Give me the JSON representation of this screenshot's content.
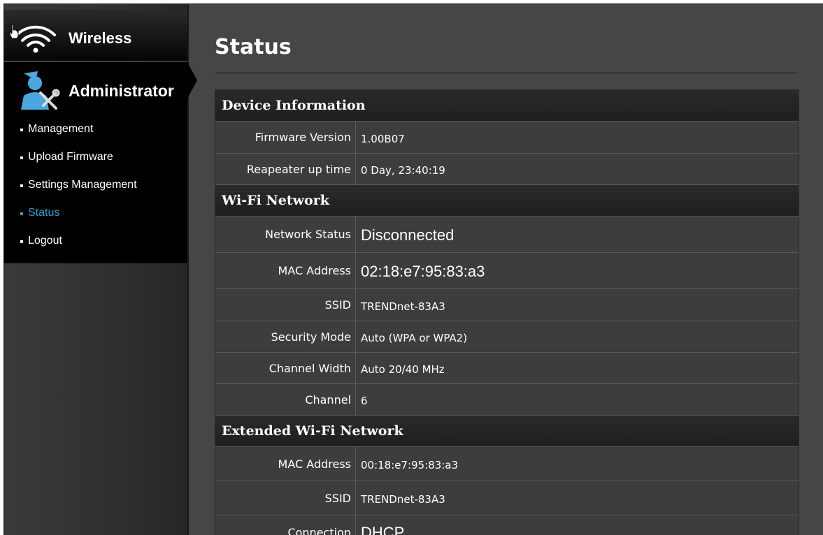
{
  "sidebar": {
    "wireless_label": "Wireless",
    "admin_label": "Administrator",
    "menu": [
      {
        "label": "Management",
        "active": false
      },
      {
        "label": "Upload Firmware",
        "active": false
      },
      {
        "label": "Settings Management",
        "active": false
      },
      {
        "label": "Status",
        "active": true
      },
      {
        "label": "Logout",
        "active": false
      }
    ],
    "icons": {
      "wireless": "wifi-icon",
      "admin": "admin-tools-icon",
      "cursor": "hand-cursor-icon"
    },
    "active_color": "#2f9fd8"
  },
  "main": {
    "title": "Status",
    "device_information": {
      "heading": "Device Information",
      "rows": [
        {
          "label": "Firmware Version",
          "value": "1.00B07"
        },
        {
          "label": "Reapeater up time",
          "value": "0 Day, 23:40:19"
        }
      ]
    },
    "wifi_network": {
      "heading": "Wi-Fi Network",
      "rows": [
        {
          "label": "Network Status",
          "value": "Disconnected"
        },
        {
          "label": "MAC Address",
          "value": "02:18:e7:95:83:a3"
        },
        {
          "label": "SSID",
          "value": "TRENDnet-83A3"
        },
        {
          "label": "Security Mode",
          "value": "Auto (WPA or WPA2)"
        },
        {
          "label": "Channel Width",
          "value": "Auto 20/40 MHz"
        },
        {
          "label": "Channel",
          "value": "6"
        }
      ]
    },
    "extended_wifi_network": {
      "heading": "Extended Wi-Fi Network",
      "rows": [
        {
          "label": "MAC Address",
          "value": "00:18:e7:95:83:a3"
        },
        {
          "label": "SSID",
          "value": "TRENDnet-83A3"
        },
        {
          "label": "Connection",
          "value": "DHCP"
        }
      ]
    }
  }
}
